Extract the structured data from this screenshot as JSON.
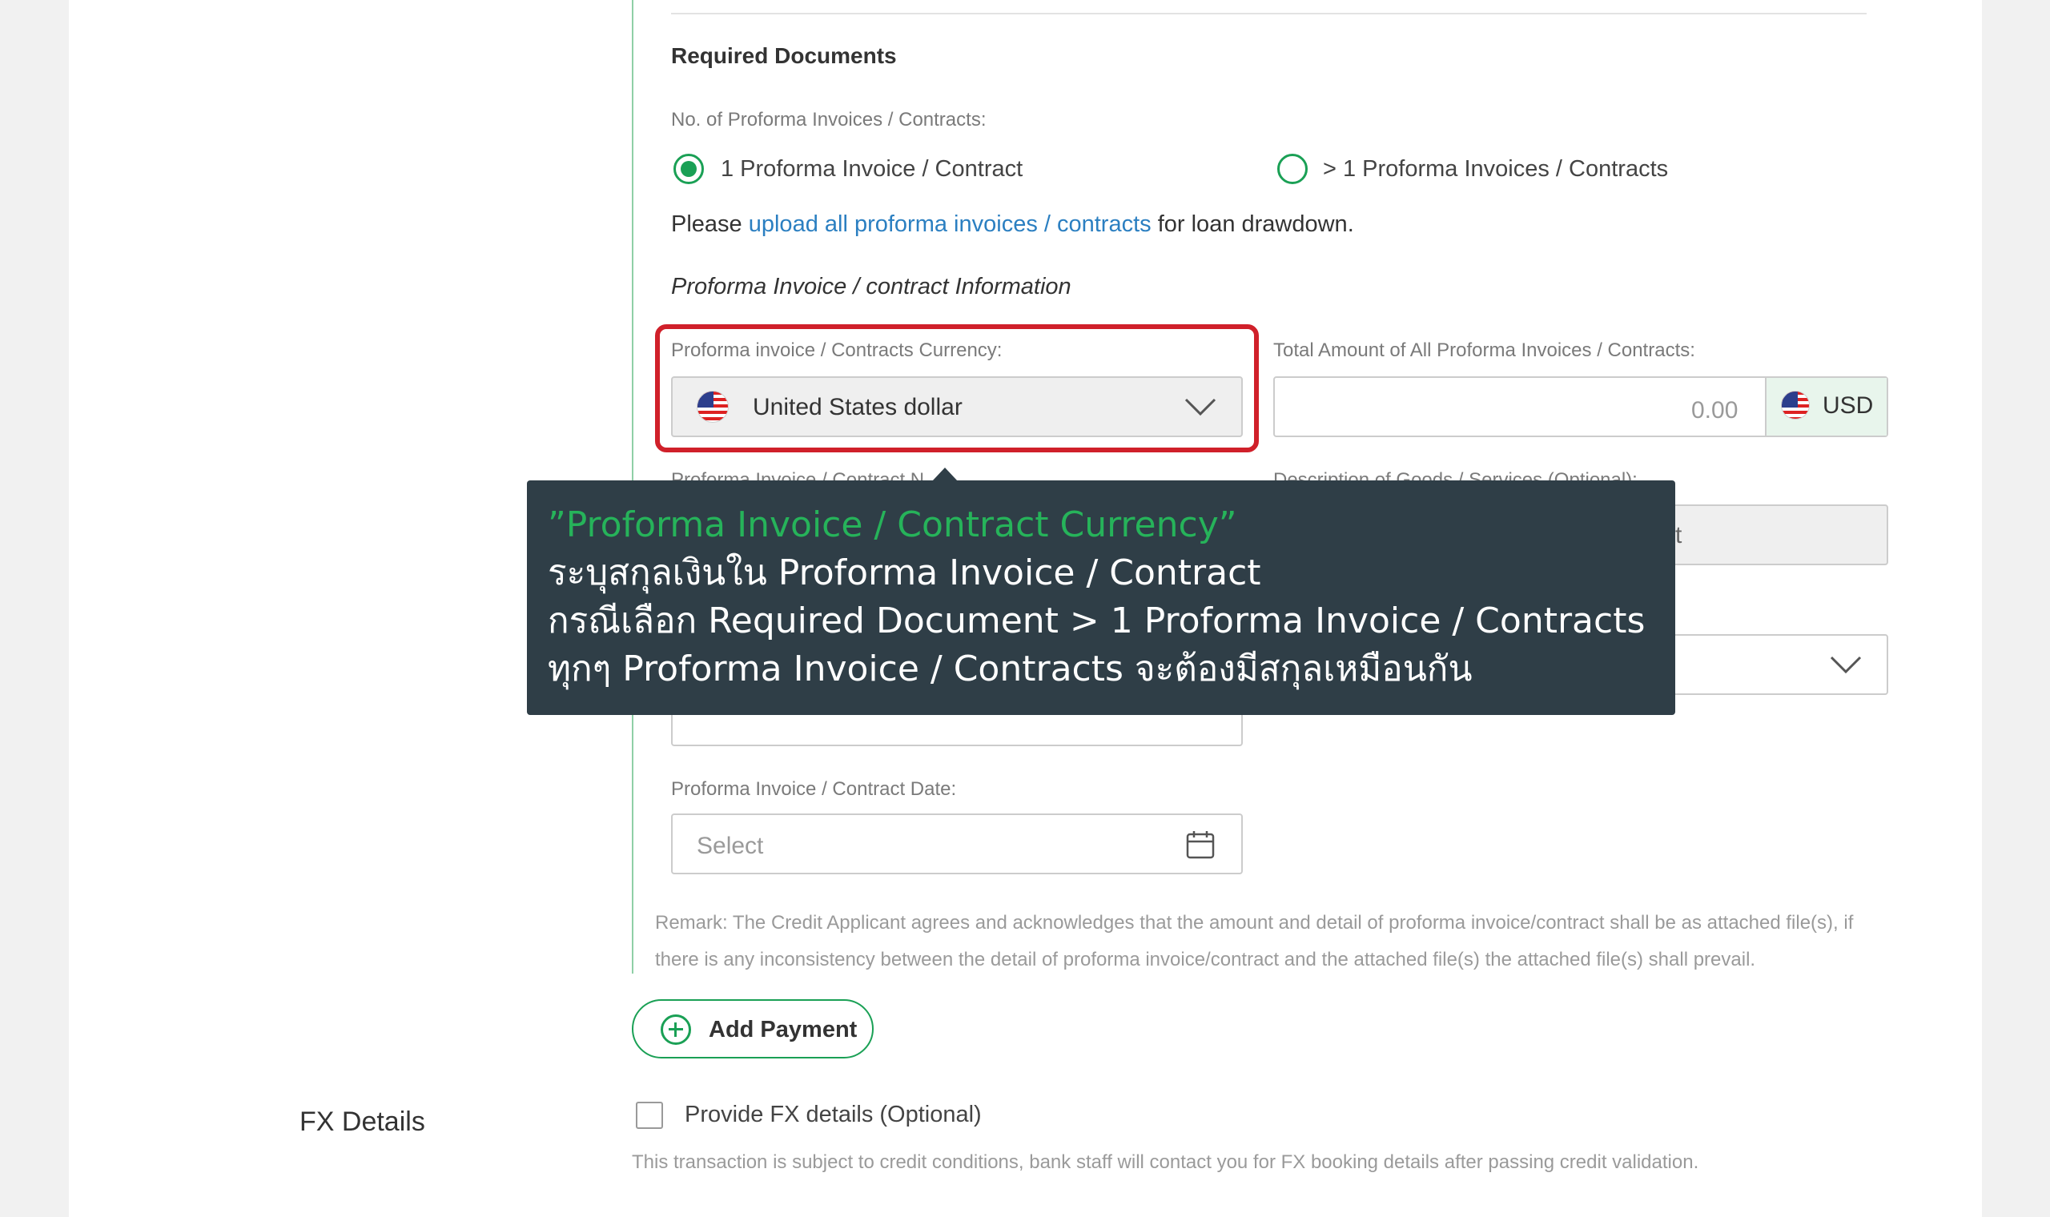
{
  "section": {
    "title": "Required Documents"
  },
  "invoices_count": {
    "label": "No. of Proforma Invoices / Contracts:",
    "options": [
      {
        "label": "1 Proforma Invoice / Contract",
        "selected": true
      },
      {
        "label": "> 1 Proforma Invoices / Contracts",
        "selected": false
      }
    ]
  },
  "note": {
    "prefix": "Please",
    "link": "upload all proforma invoices / contracts",
    "suffix": "for loan drawdown."
  },
  "subhead": "Proforma Invoice / contract Information",
  "currency": {
    "label": "Proforma invoice / Contracts Currency:",
    "value": "United States dollar",
    "icon": "us-flag-icon"
  },
  "total_amount": {
    "label": "Total Amount of All Proforma Invoices / Contracts:",
    "placeholder": "0.00",
    "currency_code": "USD",
    "icon": "us-flag-icon"
  },
  "hidden_fields": {
    "invoice_no_label": "Proforma Invoice / Contract N",
    "description_label": "Description of Goods / Services (Optional):",
    "description_partial": "t"
  },
  "invoice_date": {
    "label": "Proforma Invoice / Contract Date:",
    "placeholder": "Select",
    "icon": "calendar-icon"
  },
  "remark": {
    "line1": "Remark: The Credit Applicant agrees and acknowledges that the amount and detail of proforma invoice/contract shall be as attached file(s), if",
    "line2": "there is any inconsistency between the detail of proforma invoice/contract and the attached file(s) the attached file(s) shall prevail."
  },
  "add_payment": {
    "label": "Add Payment",
    "icon": "plus-circle-icon"
  },
  "fx": {
    "title": "FX Details",
    "checkbox_label": "Provide FX details (Optional)",
    "checked": false,
    "note": "This transaction is subject to credit conditions, bank staff will contact you for FX booking details after passing credit validation."
  },
  "tooltip": {
    "title": "”Proforma Invoice / Contract Currency”",
    "line1": "ระบุสกุลเงินใน Proforma Invoice / Contract",
    "line2": "กรณีเลือก Required Document > 1 Proforma Invoice / Contracts",
    "line3": "ทุกๆ Proforma Invoice / Contracts จะต้องมีสกุลเหมือนกัน"
  },
  "colors": {
    "accent_green": "#1aa055",
    "highlight_red": "#d0202a",
    "tooltip_bg": "#2f3e47",
    "link_blue": "#2b7fc1"
  }
}
